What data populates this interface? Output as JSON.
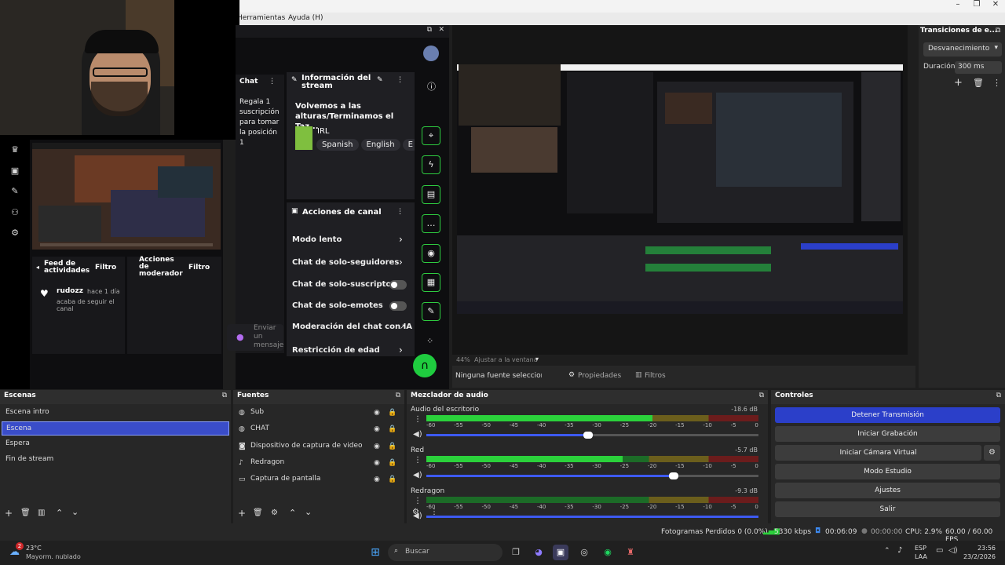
{
  "menu": {
    "tools": "Herramientas",
    "help": "Ayuda (H)"
  },
  "twitch": {
    "chat_label": "Chat",
    "chat_text": "Regala 1 suscripción para tomar la posición 1",
    "info_title": "Información del stream",
    "stream_title": "Volvemos a las alturas/Terminamos el Taz...",
    "category": "IRL",
    "tags": [
      "Spanish",
      "English",
      "E"
    ],
    "actions_title": "Acciones de canal",
    "actions": [
      {
        "label": "Modo lento",
        "control": "chevron"
      },
      {
        "label": "Chat de solo-seguidores",
        "control": "chevron"
      },
      {
        "label": "Chat de solo-suscriptores",
        "control": "toggle"
      },
      {
        "label": "Chat de solo-emotes",
        "control": "toggle"
      },
      {
        "label": "Moderación del chat con IA",
        "control": "link"
      },
      {
        "label": "Restricción de edad",
        "control": "chevron"
      }
    ],
    "feed_title": "Feed de actividades",
    "feed_filter": "Filtro",
    "mod_title": "Acciones de moderador",
    "mod_filter": "Filtro",
    "feed_user": "rudozz",
    "feed_time": "hace 1 día",
    "feed_text": "acaba de seguir el canal",
    "send_placeholder": "Enviar un mensaje"
  },
  "preview": {
    "zoom": "44%",
    "fit": "Ajustar a la ventana"
  },
  "source_toolbar": {
    "no_source": "Ninguna fuente seleccionad",
    "properties": "Propiedades",
    "filters": "Filtros"
  },
  "transitions": {
    "title": "Transiciones de e...",
    "selected": "Desvanecimiento",
    "duration_label": "Duración",
    "duration_value": "300 ms"
  },
  "scenes": {
    "title": "Escenas",
    "items": [
      "Escena intro",
      "Escena",
      "Espera",
      "Fin de stream"
    ],
    "selected": 1
  },
  "sources": {
    "title": "Fuentes",
    "items": [
      "Sub",
      "CHAT",
      "Dispositivo de captura de video",
      "Redragon",
      "Captura de pantalla"
    ]
  },
  "mixer": {
    "title": "Mezclador de audio",
    "ticks": [
      "-60",
      "-55",
      "-50",
      "-45",
      "-40",
      "-35",
      "-30",
      "-25",
      "-20",
      "-15",
      "-10",
      "-5",
      "0"
    ],
    "channels": [
      {
        "name": "Audio del escritorio",
        "db": "-18.6 dB",
        "level": 0.68,
        "volume": 0.5
      },
      {
        "name": "Red",
        "db": "-5.7 dB",
        "level": 0.59,
        "volume": 0.76
      },
      {
        "name": "Redragon",
        "db": "-9.3 dB",
        "level": 0.0,
        "volume": 1.0
      }
    ]
  },
  "controls": {
    "title": "Controles",
    "buttons": [
      "Detener Transmisión",
      "Iniciar Grabación",
      "Iniciar Cámara Virtual",
      "Modo Estudio",
      "Ajustes",
      "Salir"
    ]
  },
  "status": {
    "dropped": "Fotogramas Perdidos 0 (0.0%)",
    "bitrate": "5330 kbps",
    "live_time": "00:06:09",
    "rec_time": "00:00:00",
    "cpu": "CPU: 2.9%",
    "fps": "60.00 / 60.00 FPS"
  },
  "taskbar": {
    "temp": "23°C",
    "weather": "Mayorm. nublado",
    "search": "Buscar",
    "lang": "ESP",
    "lang2": "LAA",
    "time": "23:56",
    "date": "23/2/2026",
    "badge": "2"
  }
}
